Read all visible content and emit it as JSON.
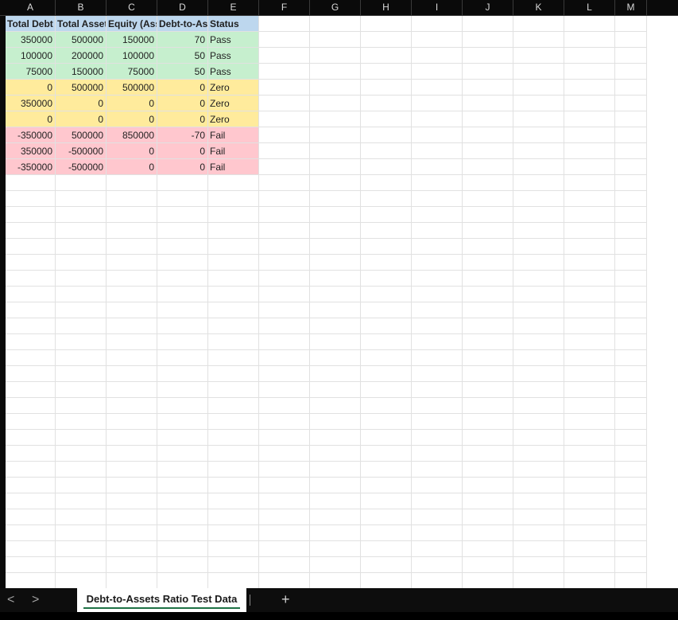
{
  "columns": [
    "A",
    "B",
    "C",
    "D",
    "E",
    "F",
    "G",
    "H",
    "I",
    "J",
    "K",
    "L",
    "M"
  ],
  "sheet": {
    "header": [
      "Total Debt",
      "Total Assets",
      "Equity (Assets-Debt)",
      "Debt-to-Assets",
      "Status"
    ],
    "rows": [
      {
        "cells": [
          "350000",
          "500000",
          "150000",
          "70",
          "Pass"
        ],
        "fill": "#c6efce"
      },
      {
        "cells": [
          "100000",
          "200000",
          "100000",
          "50",
          "Pass"
        ],
        "fill": "#c6efce"
      },
      {
        "cells": [
          "75000",
          "150000",
          "75000",
          "50",
          "Pass"
        ],
        "fill": "#c6efce"
      },
      {
        "cells": [
          "0",
          "500000",
          "500000",
          "0",
          "Zero"
        ],
        "fill": "#ffeb9c"
      },
      {
        "cells": [
          "350000",
          "0",
          "0",
          "0",
          "Zero"
        ],
        "fill": "#ffeb9c"
      },
      {
        "cells": [
          "0",
          "0",
          "0",
          "0",
          "Zero"
        ],
        "fill": "#ffeb9c"
      },
      {
        "cells": [
          "-350000",
          "500000",
          "850000",
          "-70",
          "Fail"
        ],
        "fill": "#ffc7ce"
      },
      {
        "cells": [
          "350000",
          "-500000",
          "0",
          "0",
          "Fail"
        ],
        "fill": "#ffc7ce"
      },
      {
        "cells": [
          "-350000",
          "-500000",
          "0",
          "0",
          "Fail"
        ],
        "fill": "#ffc7ce"
      }
    ],
    "header_fill": "#bdd7ee"
  },
  "tabs": {
    "prev_icon": "chevron-left-icon",
    "next_icon": "chevron-right-icon",
    "prev_glyph": "<",
    "next_glyph": ">",
    "active_sheet": "Debt-to-Assets Ratio Test Data",
    "add_glyph": "+",
    "accent": "#1e7145"
  }
}
